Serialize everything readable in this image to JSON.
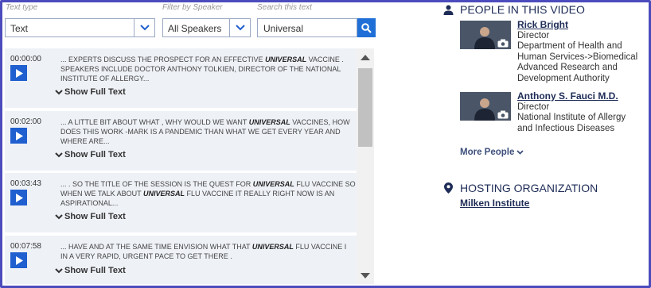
{
  "filters": {
    "text_type_label": "Text type",
    "text_type_value": "Text",
    "speaker_label": "Filter by Speaker",
    "speaker_value": "All Speakers",
    "search_label": "Search this text",
    "search_value": "Universal"
  },
  "show_full_label": "Show Full Text",
  "transcript": [
    {
      "time": "00:00:00",
      "lines": [
        [
          "... EXPERTS DISCUSS THE PROSPECT FOR AN EFFECTIVE ",
          "UNIVERSAL",
          " VACCINE ."
        ],
        [
          "SPEAKERS INCLUDE DOCTOR ANTHONY TOLKIEN, DIRECTOR OF THE NATIONAL"
        ],
        [
          "INSTITUTE OF ALLERGY..."
        ]
      ]
    },
    {
      "time": "00:02:00",
      "lines": [
        [
          "... A LITTLE BIT ABOUT WHAT , WHY WOULD WE WANT ",
          "UNIVERSAL",
          " VACCINES, HOW"
        ],
        [
          "DOES THIS WORK -MARK IS A PANDEMIC THAN WHAT WE GET EVERY YEAR AND"
        ],
        [
          "WHERE ARE..."
        ]
      ]
    },
    {
      "time": "00:03:43",
      "lines": [
        [
          "... . SO THE TITLE OF THE SESSION IS THE QUEST FOR ",
          "UNIVERSAL",
          " FLU VACCINE SO"
        ],
        [
          "WHEN WE TALK ABOUT ",
          "UNIVERSAL",
          " FLU VACCINE IT REALLY RIGHT NOW IS AN"
        ],
        [
          "ASPIRATIONAL..."
        ]
      ]
    },
    {
      "time": "00:07:58",
      "lines": [
        [
          "... HAVE AND AT THE SAME TIME ENVISION WHAT THAT ",
          "UNIVERSAL",
          " FLU VACCINE I"
        ],
        [
          "IN A VERY RAPID, URGENT PACE TO GET THERE ."
        ]
      ]
    }
  ],
  "people_section": {
    "heading": "PEOPLE IN THIS VIDEO",
    "people": [
      {
        "name": "Rick Bright",
        "role": "Director",
        "org_lines": [
          "Department of Health and",
          "Human Services->Biomedical",
          "Advanced Research and",
          "Development Authority"
        ]
      },
      {
        "name": "Anthony S. Fauci M.D.",
        "role": "Director",
        "org_lines": [
          "National Institute of Allergy",
          "and Infectious Diseases"
        ]
      }
    ],
    "more_label": "More People"
  },
  "hosting": {
    "heading": "HOSTING ORGANIZATION",
    "org": "Milken Institute"
  },
  "colors": {
    "accent_blue": "#1f5fcf",
    "heading_navy": "#1e2c57",
    "entry_bg": "#eef1f6",
    "frame": "#4b4bbd"
  },
  "icons": [
    "chevron-down-icon",
    "search-icon",
    "play-icon",
    "person-icon",
    "location-pin-icon",
    "camera-icon"
  ]
}
